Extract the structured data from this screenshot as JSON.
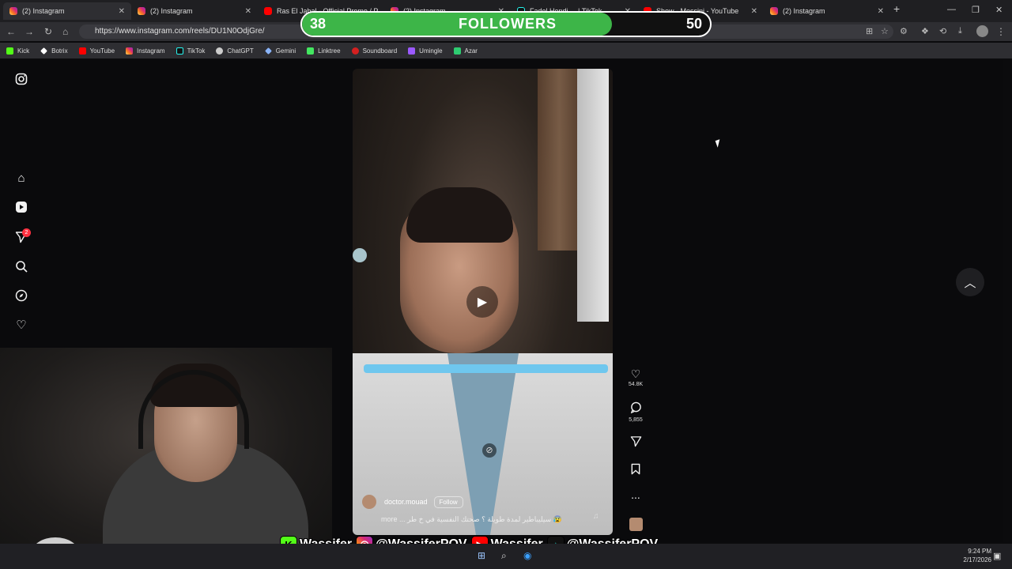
{
  "browser": {
    "tabs": [
      {
        "title": "(2) Instagram",
        "icon": "instagram",
        "active": true
      },
      {
        "title": "(2) Instagram",
        "icon": "instagram",
        "active": false
      },
      {
        "title": "Ras El Jabal - Official Promo / Pr...",
        "icon": "youtube",
        "active": false
      },
      {
        "title": "(2) Instagram",
        "icon": "instagram",
        "active": false
      },
      {
        "title": "Fadel Hendi ... | TikTok",
        "icon": "tiktok",
        "active": false
      },
      {
        "title": "Show - Messini - YouTube",
        "icon": "youtube",
        "active": false
      },
      {
        "title": "(2) Instagram",
        "icon": "instagram",
        "active": false
      }
    ],
    "url": "https://www.instagram.com/reels/DU1N0OdjGre/",
    "bookmarks": [
      {
        "label": "Kick",
        "color": "#53fc18"
      },
      {
        "label": "Botrix",
        "color": "#ffffff"
      },
      {
        "label": "YouTube",
        "color": "#ff0000"
      },
      {
        "label": "Instagram",
        "color": "#d62976"
      },
      {
        "label": "TikTok",
        "color": "#25f4ee"
      },
      {
        "label": "ChatGPT",
        "color": "#cccccc"
      },
      {
        "label": "Gemini",
        "color": "#8ab4f8"
      },
      {
        "label": "Linktree",
        "color": "#43e660"
      },
      {
        "label": "Soundboard",
        "color": "#d42020"
      },
      {
        "label": "Umingle",
        "color": "#9b59ff"
      },
      {
        "label": "Azar",
        "color": "#2ecc71"
      }
    ]
  },
  "overlay": {
    "followers_current": "38",
    "followers_label": "FOLLOWERS",
    "followers_goal": "50",
    "followers_progress": 0.76,
    "socials": [
      {
        "platform": "kick",
        "icon_char": "K",
        "handle": "Wassifer",
        "color": "#53fc18"
      },
      {
        "platform": "instagram",
        "icon_char": "◎",
        "handle": "@WassiferPOV",
        "color": "#d62976"
      },
      {
        "platform": "youtube",
        "icon_char": "▶",
        "handle": "Wassifer",
        "color": "#ff0000"
      },
      {
        "platform": "tiktok",
        "icon_char": "♪",
        "handle": "@WassiferPOV",
        "color": "#111111"
      }
    ]
  },
  "reel": {
    "author": "doctor.mouad",
    "follow_label": "Follow",
    "caption": "more ... سيليباطير لمدة طويلة ؟ صحتك النفسية في خ طر 😰",
    "likes": "54.8K",
    "comments": "5,855",
    "more": "..."
  },
  "sidebar": {
    "notifications_badge": "2"
  },
  "taskbar": {
    "time": "9:24 PM",
    "date": "2/17/2026"
  },
  "colors": {
    "accent_green": "#3db548",
    "cyan_bar": "#6fc7ee",
    "badge_red": "#ff3040"
  }
}
